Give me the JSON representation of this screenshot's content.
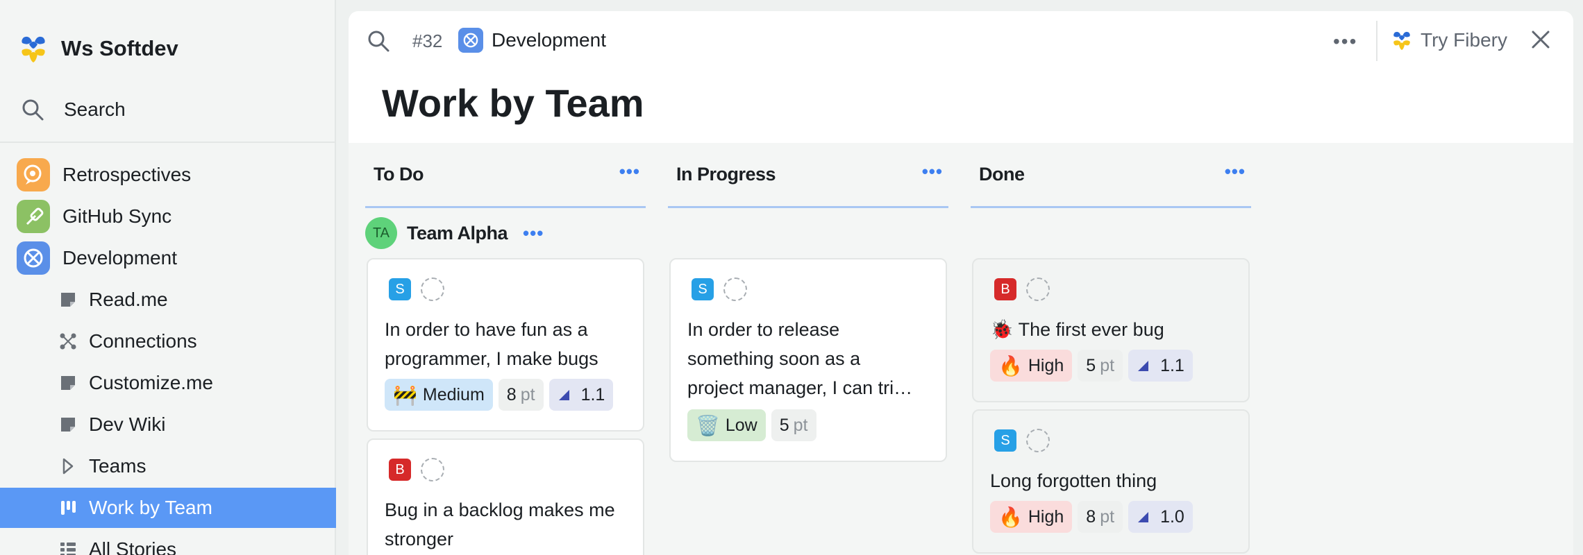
{
  "workspace": {
    "name": "Ws Softdev"
  },
  "sidebar": {
    "search_label": "Search",
    "apps": [
      {
        "label": "Retrospectives",
        "icon": "chat-bubble-icon",
        "color": "#f8a94d"
      },
      {
        "label": "GitHub Sync",
        "icon": "git-pin-icon",
        "color": "#8cc164"
      },
      {
        "label": "Development",
        "icon": "bug-icon",
        "color": "#5a8fe8"
      }
    ],
    "items": [
      {
        "label": "Read.me",
        "icon": "document-icon"
      },
      {
        "label": "Connections",
        "icon": "connections-icon"
      },
      {
        "label": "Customize.me",
        "icon": "document-icon"
      },
      {
        "label": "Dev Wiki",
        "icon": "document-icon"
      },
      {
        "label": "Teams",
        "icon": "chevron-right-icon"
      },
      {
        "label": "Work by Team",
        "icon": "board-icon",
        "active": true
      },
      {
        "label": "All Stories",
        "icon": "list-icon"
      }
    ]
  },
  "topbar": {
    "view_id": "#32",
    "database_name": "Development",
    "more": "•••",
    "try_label": "Try Fibery"
  },
  "view": {
    "title": "Work by Team"
  },
  "board": {
    "columns": [
      {
        "title": "To Do",
        "more": "•••"
      },
      {
        "title": "In Progress",
        "more": "•••"
      },
      {
        "title": "Done",
        "more": "•••"
      }
    ],
    "lane": {
      "initials": "TA",
      "name": "Team Alpha",
      "more": "•••"
    },
    "cards": [
      {
        "column": "To Do",
        "type": "S",
        "title": "In order to have fun as a programmer, I make bugs",
        "priority_emoji": "🚧",
        "priority": "Medium",
        "points": "8",
        "points_unit": "pt",
        "release": "1.1"
      },
      {
        "column": "To Do",
        "type": "B",
        "title": "Bug in a backlog makes me stronger"
      },
      {
        "column": "In Progress",
        "type": "S",
        "title_line1": "In order to release",
        "title_line2": "something soon as a",
        "title_line3": "project manager, I can tri…",
        "priority_emoji": "🗑️",
        "priority": "Low",
        "points": "5",
        "points_unit": "pt"
      },
      {
        "column": "Done",
        "type": "B",
        "title": "🐞 The first ever bug",
        "priority_emoji": "🔥",
        "priority": "High",
        "points": "5",
        "points_unit": "pt",
        "release": "1.1"
      },
      {
        "column": "Done",
        "type": "S",
        "title": "Long forgotten thing",
        "priority_emoji": "🔥",
        "priority": "High",
        "points": "8",
        "points_unit": "pt",
        "release": "1.0"
      }
    ]
  },
  "colors": {
    "accent": "#5a98f5",
    "link": "#3d7ff0",
    "column_rule": "#a9c7f3"
  }
}
